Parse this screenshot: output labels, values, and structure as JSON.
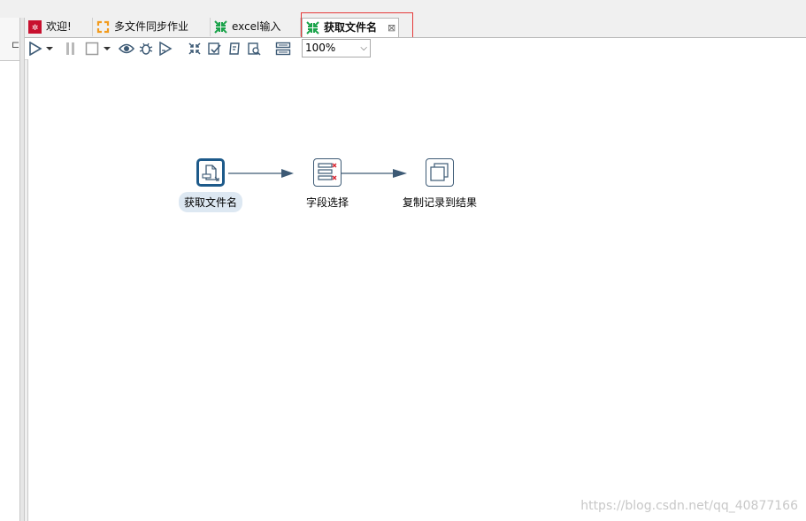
{
  "tabs": [
    {
      "label": "欢迎!",
      "icon": "kettle-welcome-icon"
    },
    {
      "label": "多文件同步作业",
      "icon": "job-icon"
    },
    {
      "label": "excel输入",
      "icon": "transformation-icon"
    },
    {
      "label": "获取文件名",
      "icon": "transformation-icon",
      "active": true,
      "close": "⊠"
    }
  ],
  "toolbar": {
    "zoom": "100%",
    "buttons": [
      "run-icon",
      "run-dropdown-icon",
      "pause-icon",
      "stop-icon",
      "stop-dropdown-icon",
      "preview-icon",
      "debug-icon",
      "replay-icon",
      "verify-icon",
      "impact-icon",
      "sql-icon",
      "explore-db-icon",
      "show-results-icon"
    ]
  },
  "steps": [
    {
      "label": "获取文件名",
      "icon": "get-file-names-icon",
      "selected": true
    },
    {
      "label": "字段选择",
      "icon": "select-values-icon",
      "selected": false
    },
    {
      "label": "复制记录到结果",
      "icon": "copy-rows-to-result-icon",
      "selected": false
    }
  ],
  "watermark": "https://blog.csdn.net/qq_40877166",
  "colors": {
    "accent": "#1d5a8a",
    "hop": "#3d5a75",
    "highlight": "#e53a3a",
    "transformation_green": "#1aa34a",
    "job_orange": "#f29b1e",
    "welcome_red": "#c8102e"
  }
}
